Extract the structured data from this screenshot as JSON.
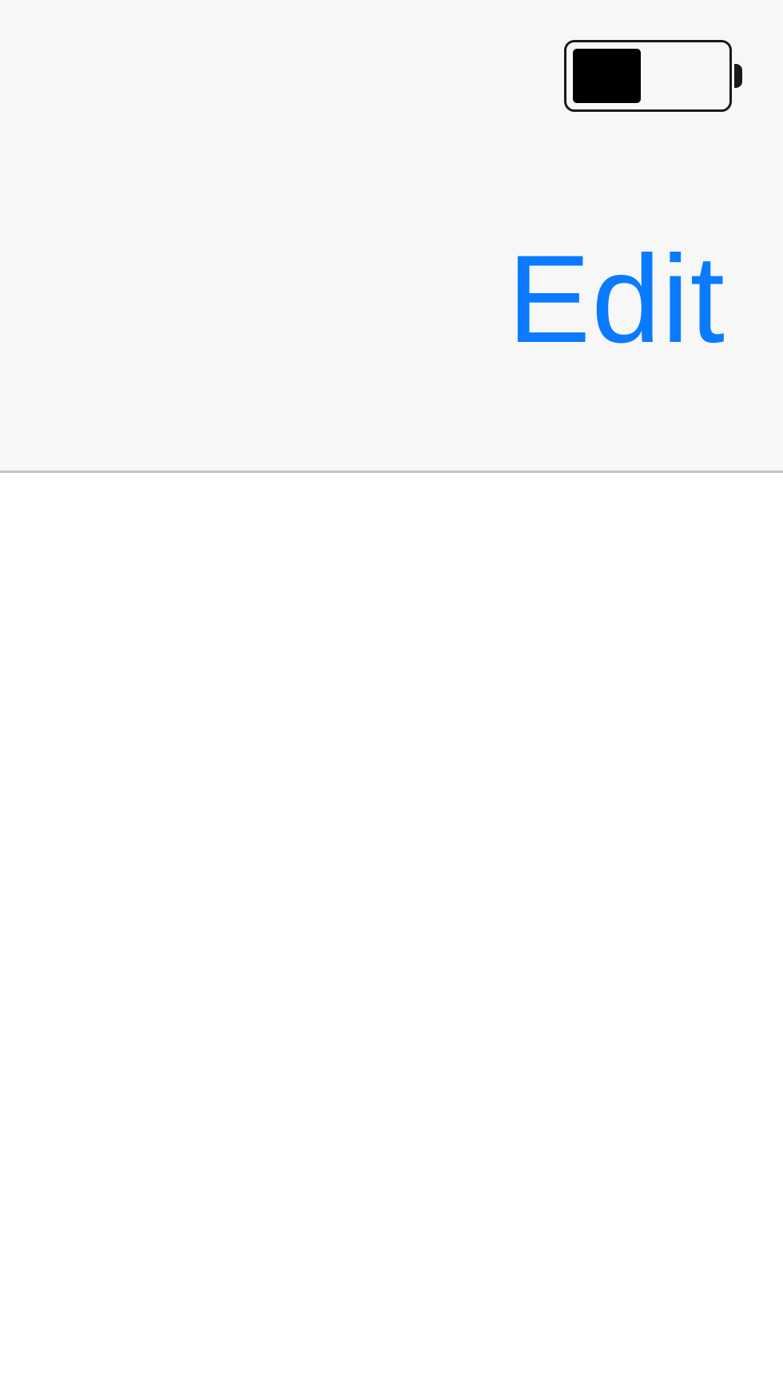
{
  "status_bar": {
    "battery_level_percent": 45,
    "battery_icon": "battery-icon"
  },
  "nav_bar": {
    "edit_label": "Edit"
  },
  "colors": {
    "accent": "#0a7aff",
    "nav_background": "#f7f7f7",
    "separator": "#c4c4c4",
    "content_background": "#ffffff"
  }
}
